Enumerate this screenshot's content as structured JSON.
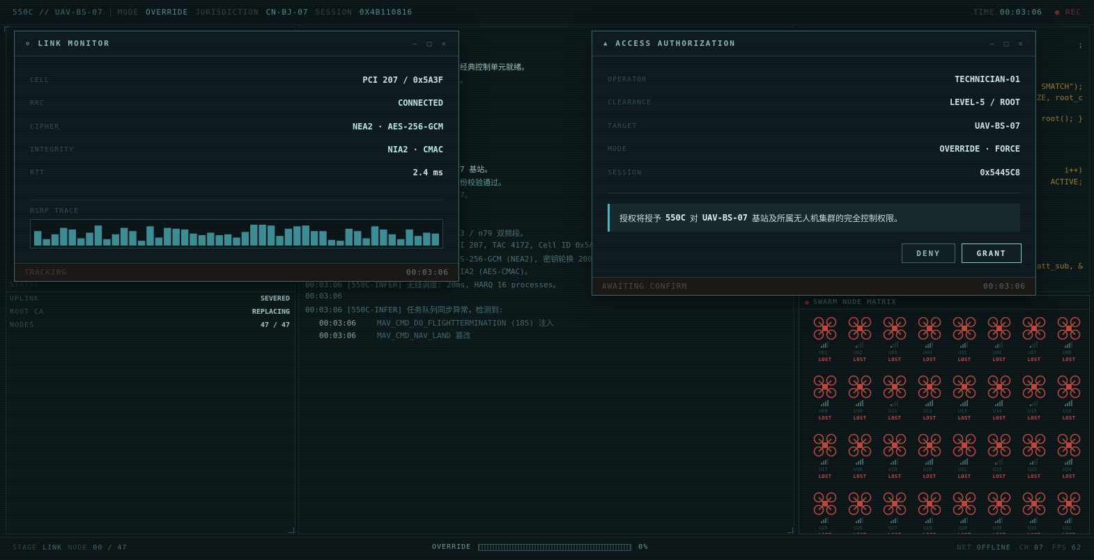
{
  "topbar": {
    "brand": "550C // UAV-BS-07",
    "mode_label": "MODE",
    "mode_value": "OVERRIDE",
    "jurisdiction_label": "JURISDICTION",
    "jurisdiction_value": "CN-BJ-07",
    "session_label": "SESSION",
    "session_value": "0X4B110816",
    "time_label": "TIME",
    "time_value": "00:03:06",
    "rec": "● REC"
  },
  "status_panel": {
    "title": "STATUS",
    "rows": [
      {
        "k": "UPLINK",
        "v": "SEVERED"
      },
      {
        "k": "ROOT CA",
        "v": "REPLACING"
      },
      {
        "k": "NODES",
        "v": "47 / 47"
      }
    ]
  },
  "log": {
    "lines": [
      {
        "text": "经典控制单元就绪。"
      },
      {
        "text": "。"
      },
      {
        "text": "7 基站。"
      },
      {
        "text": "份校验通过。"
      },
      {
        "text": "7。"
      },
      {
        "text": "3 / n79 双频段。"
      },
      {
        "text": "I 207, TAC 4172, Cell ID 0x5A"
      },
      {
        "text": "S-256-GCM (NEA2), 密钥轮换 200"
      },
      {
        "text": "IA2 (AES-CMAC)。"
      },
      {
        "text": "00:03:06 [550C-INFER] 无线调度: 20ms, HARQ 16 processes。"
      },
      {
        "text": "00:03:06"
      },
      {
        "text": "00:03:06 [550C-INFER] 任务队列同步异常，检测到:"
      }
    ],
    "injected": [
      {
        "ts": "00:03:06",
        "cmd": "MAV_CMD_DO_FLIGHTTERMINATION (185) 注入"
      },
      {
        "ts": "00:03:06",
        "cmd": "MAV_CMD_NAV_LAND 篡改"
      }
    ]
  },
  "code": {
    "lines": [
      ";",
      "SMATCH\");",
      "_SIZE, root_c",
      "root(); }",
      "i++)",
      "ACTIVE;",
      "), att_sub, &"
    ]
  },
  "link_monitor": {
    "title": "LINK MONITOR",
    "rows": [
      {
        "k": "CELL",
        "v": "PCI 207 / 0x5A3F"
      },
      {
        "k": "RRC",
        "v": "CONNECTED"
      },
      {
        "k": "CIPHER",
        "v": "NEA2 · AES-256-GCM"
      },
      {
        "k": "INTEGRITY",
        "v": "NIA2 · CMAC"
      },
      {
        "k": "RTT",
        "v": "2.4 ms"
      }
    ],
    "trace_label": "RSRP TRACE",
    "trace": [
      18,
      8,
      14,
      22,
      20,
      9,
      16,
      25,
      8,
      14,
      22,
      18,
      6,
      24,
      10,
      22,
      21,
      20,
      15,
      13,
      16,
      13,
      14,
      10,
      17,
      26,
      26,
      25,
      12,
      21,
      24,
      25,
      18,
      18,
      7,
      6,
      21,
      18,
      9,
      24,
      20,
      14,
      8,
      20,
      12,
      16,
      15
    ],
    "footer_label": "TRACKING",
    "footer_time": "00:03:06"
  },
  "auth": {
    "title": "ACCESS AUTHORIZATION",
    "rows": [
      {
        "k": "OPERATOR",
        "v": "TECHNICIAN-01"
      },
      {
        "k": "CLEARANCE",
        "v": "LEVEL-5 / ROOT"
      },
      {
        "k": "TARGET",
        "v": "UAV-BS-07"
      },
      {
        "k": "MODE",
        "v": "OVERRIDE · FORCE"
      },
      {
        "k": "SESSION",
        "v": "0x5445C8"
      }
    ],
    "message_pre": "授权将授予",
    "message_subject": "550C",
    "message_mid": "对",
    "message_target": "UAV-BS-07",
    "message_post": "基站及所属无人机集群的完全控制权限。",
    "deny_label": "DENY",
    "grant_label": "GRANT",
    "footer_label": "AWAITING CONFIRM",
    "footer_time": "00:03:06"
  },
  "swarm": {
    "title": "SWARM NODE MATRIX",
    "status_label": "LOST",
    "node_count": 32
  },
  "bottombar": {
    "stage_label": "STAGE",
    "stage_value": "LINK",
    "node_label": "NODE",
    "node_value": "00 / 47",
    "override_label": "OVERRIDE",
    "override_percent_text": "0%",
    "override_progress": 0,
    "net_label": "NET",
    "net_value": "OFFLINE",
    "ch_label": "CH",
    "ch_value": "07",
    "fps_label": "FPS",
    "fps_value": "62"
  },
  "colors": {
    "accent": "#4fb6c0",
    "alert": "#d14a4a",
    "node": "#b8473c"
  }
}
